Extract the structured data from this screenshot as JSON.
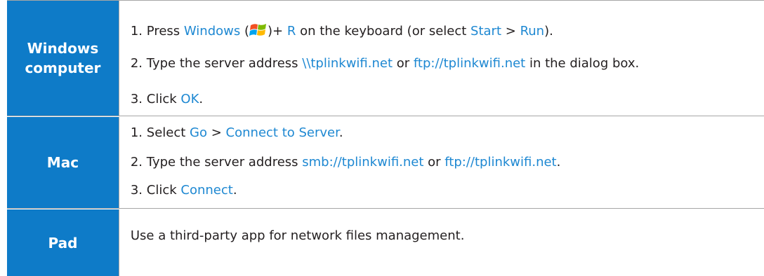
{
  "rows": [
    {
      "label": "Windows\ncomputer",
      "steps": [
        {
          "num": "1.",
          "t1": "Press ",
          "k1": "Windows",
          "t2": " (",
          "t3": ")+ ",
          "k2": "R",
          "t4": " on the keyboard (or select ",
          "k3": "Start",
          "t5": " > ",
          "k4": "Run",
          "t6": ")."
        },
        {
          "num": "2.",
          "t1": "Type the server address ",
          "k1": "\\\\tplinkwifi.net",
          "t2": " or ",
          "k2": "ftp://tplinkwifi.net",
          "t3": " in the dialog box."
        },
        {
          "num": "3.",
          "t1": "Click ",
          "k1": "OK",
          "t2": "."
        }
      ]
    },
    {
      "label": "Mac",
      "steps": [
        {
          "num": "1.",
          "t1": "Select ",
          "k1": "Go",
          "t2": " > ",
          "k2": "Connect to Server",
          "t3": "."
        },
        {
          "num": "2.",
          "t1": "Type the server address ",
          "k1": "smb://tplinkwifi.net",
          "t2": " or ",
          "k2": "ftp://tplinkwifi.net",
          "t3": "."
        },
        {
          "num": "3.",
          "t1": "Click ",
          "k1": "Connect",
          "t2": "."
        }
      ]
    },
    {
      "label": "Pad",
      "text": "Use a third-party app for network files management."
    }
  ],
  "icons": {
    "windows_logo": "windows-logo-icon"
  },
  "colors": {
    "header_bg": "#0e7bc8",
    "highlight": "#1e88d2",
    "border": "#a6a6a6"
  }
}
